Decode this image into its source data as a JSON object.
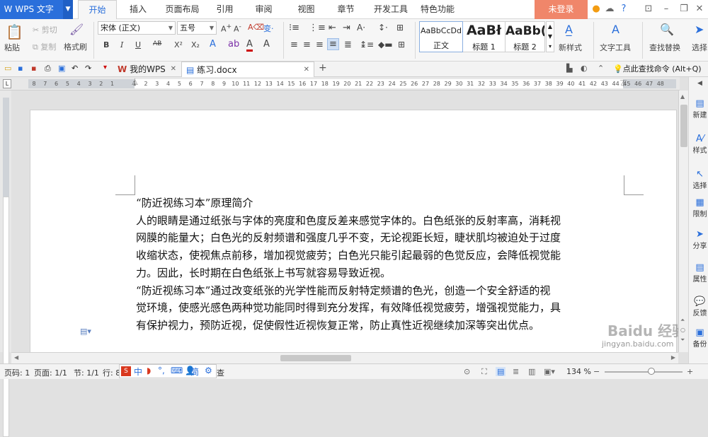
{
  "app": {
    "name": "WPS 文字",
    "login": "未登录"
  },
  "menu_tabs": [
    "开始",
    "插入",
    "页面布局",
    "引用",
    "审阅",
    "视图",
    "章节",
    "开发工具",
    "特色功能"
  ],
  "ribbon": {
    "paste": "粘贴",
    "cut": "剪切",
    "copy": "复制",
    "format_painter": "格式刷",
    "font_name": "宋体 (正文)",
    "font_size": "五号",
    "styles": [
      {
        "preview": "AaBbCcDd",
        "name": "正文"
      },
      {
        "preview": "AaBł",
        "name": "标题 1"
      },
      {
        "preview": "AaBb(",
        "name": "标题 2"
      }
    ],
    "new_style": "新样式",
    "text_tools": "文字工具",
    "find_replace": "查找替换",
    "select": "选择",
    "bold": "B",
    "italic": "I",
    "underline": "U",
    "abc": "AB",
    "sup": "X²",
    "sub": "X₂"
  },
  "doc_tabs": [
    {
      "label": "我的WPS"
    },
    {
      "label": "练习.docx"
    }
  ],
  "search_hint": "点此查找命令 (Alt+Q)",
  "ruler_ticks": [
    "8",
    "7",
    "6",
    "5",
    "4",
    "3",
    "2",
    "1",
    "",
    "1",
    "2",
    "3",
    "4",
    "5",
    "6",
    "7",
    "8",
    "9",
    "10",
    "11",
    "12",
    "13",
    "14",
    "15",
    "16",
    "17",
    "18",
    "19",
    "20",
    "21",
    "22",
    "23",
    "24",
    "25",
    "26",
    "27",
    "28",
    "29",
    "30",
    "31",
    "32",
    "33",
    "34",
    "35",
    "36",
    "37",
    "38",
    "39",
    "40",
    "41",
    "42",
    "43",
    "44",
    "45",
    "46",
    "47",
    "48"
  ],
  "document": {
    "lines": [
      "“防近视练习本”原理简介",
      "人的眼睛是通过纸张与字体的亮度和色度反差来感觉字体的。白色纸张的反射率高，消耗视",
      "网膜的能量大；白色光的反射频谱和强度几乎不变，无论视距长短，睫状肌均被迫处于过度",
      "收缩状态，使视焦点前移，增加视觉疲劳；白色光只能引起最弱的色觉反应，会降低视觉能",
      "力。因此，长时期在白色纸张上书写就容易导致近视。",
      "“防近视练习本”通过改变纸张的光学性能而反射特定频谱的色光，创造一个安全舒适的视",
      "觉环境，使感光感色两种觉功能同时得到充分发挥，有效降低视觉疲劳，增强视觉能力，具",
      "有保护视力，预防近视，促使假性近视恢复正常，防止真性近视继续加深等突出优点。"
    ]
  },
  "side_panel": [
    "新建",
    "样式",
    "选择",
    "限制",
    "分享",
    "属性",
    "反馈",
    "备份"
  ],
  "status": {
    "page_no": "页码: 1",
    "pages": "页面: 1/1",
    "section": "节: 1/1",
    "row": "行: 8",
    "zoom": "134 %",
    "ime_text": "中",
    "ime_mode": "简",
    "check": "查"
  },
  "watermark": {
    "site": "jingyan.baidu.com",
    "brand": "Baidu 经验"
  }
}
